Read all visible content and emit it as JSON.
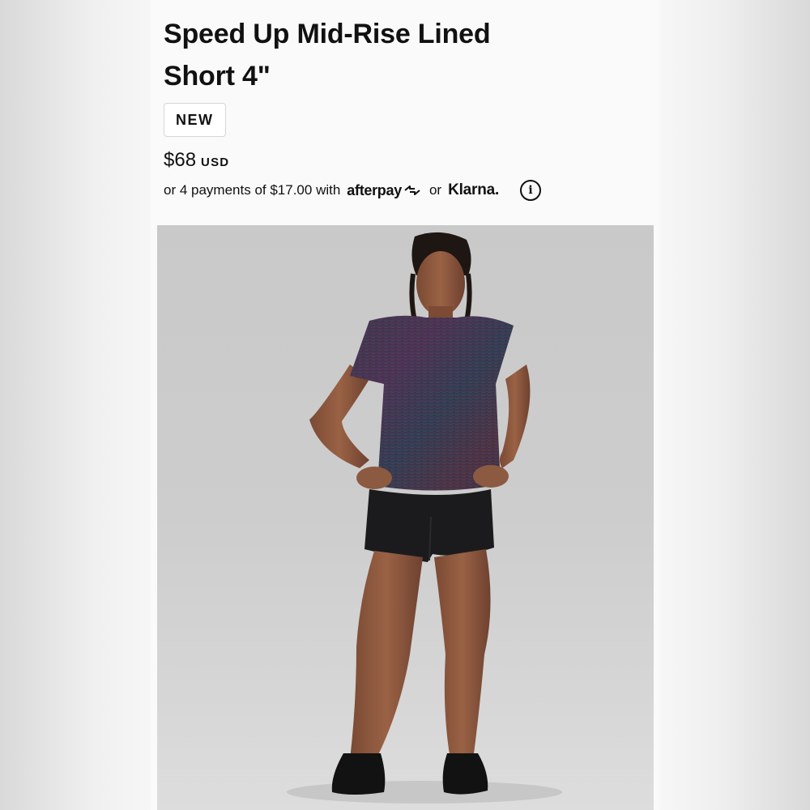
{
  "product": {
    "title": "Speed Up Mid-Rise Lined Short 4\"",
    "badge": "NEW",
    "price": "$68",
    "currency": "USD"
  },
  "payment": {
    "prefix": "or 4 payments of $17.00 with",
    "provider_1": "afterpay",
    "separator": "or",
    "provider_2": "Klarna."
  },
  "icons": {
    "info": "info-icon",
    "afterpay_logo": "afterpay-arrows-icon"
  },
  "image": {
    "subject": "product-photo"
  }
}
